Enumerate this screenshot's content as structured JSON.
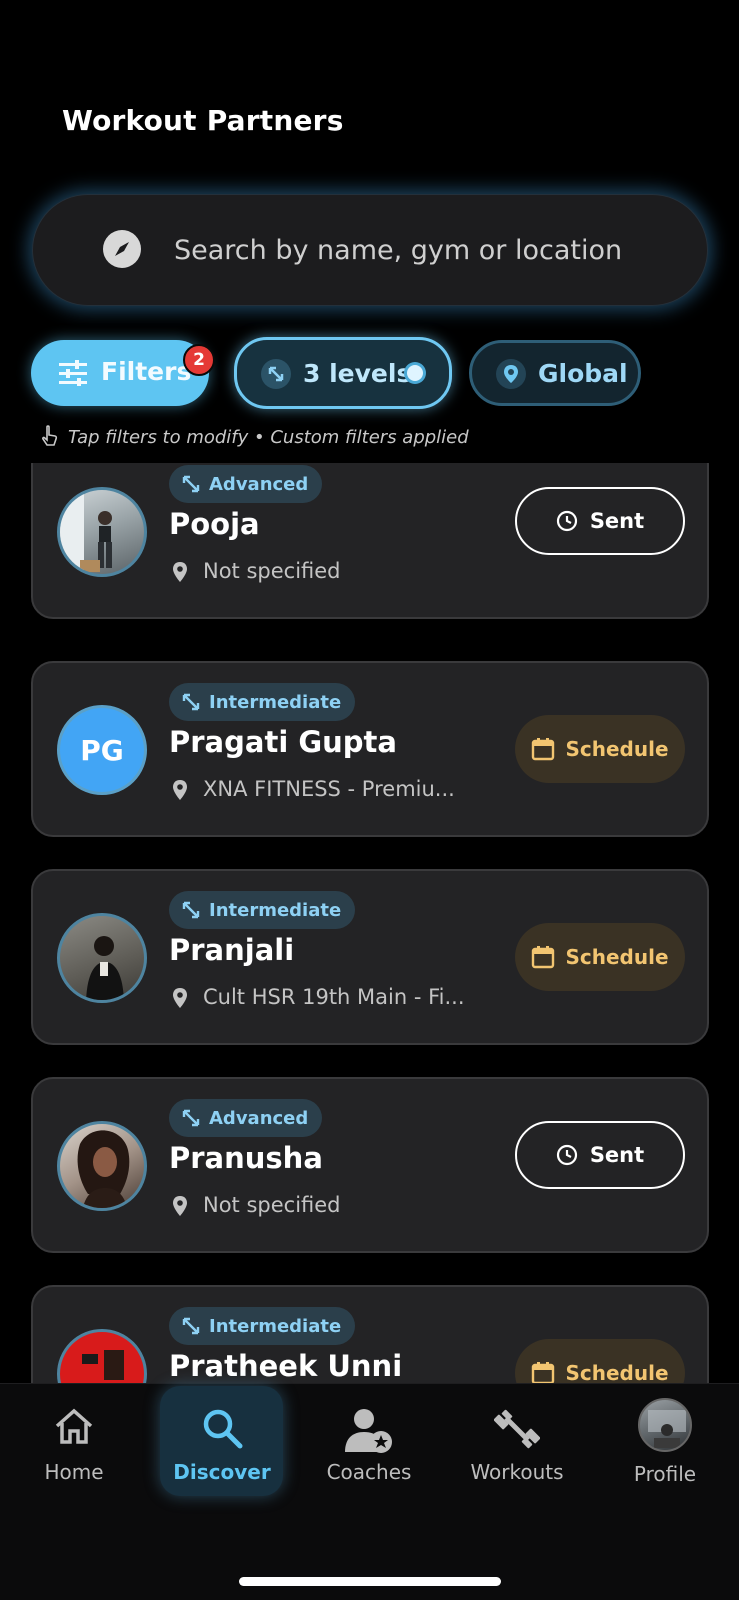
{
  "header": {
    "title": "Workout Partners"
  },
  "search": {
    "placeholder": "Search by name, gym or location",
    "icon": "compass-icon"
  },
  "chips": {
    "filters": {
      "label": "Filters",
      "badge": "2"
    },
    "levels": {
      "label": "3 levels"
    },
    "global": {
      "label": "Global"
    }
  },
  "hint": "Tap filters to modify • Custom filters applied",
  "partners": [
    {
      "level": "Advanced",
      "name": "Pooja",
      "location": "Not specified",
      "action": "Sent",
      "avatar": "photo"
    },
    {
      "level": "Intermediate",
      "name": "Pragati Gupta",
      "location": "XNA FITNESS - Premiu...",
      "action": "Schedule",
      "avatar": "initials",
      "initials": "PG"
    },
    {
      "level": "Intermediate",
      "name": "Pranjali",
      "location": "Cult HSR 19th Main - Fi...",
      "action": "Schedule",
      "avatar": "photo"
    },
    {
      "level": "Advanced",
      "name": "Pranusha",
      "location": "Not specified",
      "action": "Sent",
      "avatar": "photo"
    },
    {
      "level": "Intermediate",
      "name": "Pratheek Unni",
      "location": "",
      "action": "Schedule",
      "avatar": "photo"
    }
  ],
  "nav": {
    "home": "Home",
    "discover": "Discover",
    "coaches": "Coaches",
    "workouts": "Workouts",
    "profile": "Profile",
    "active": "discover"
  },
  "colors": {
    "accent": "#5ec5f2",
    "schedule": "#f2c571",
    "badge": "#e53935",
    "card": "#232325"
  }
}
